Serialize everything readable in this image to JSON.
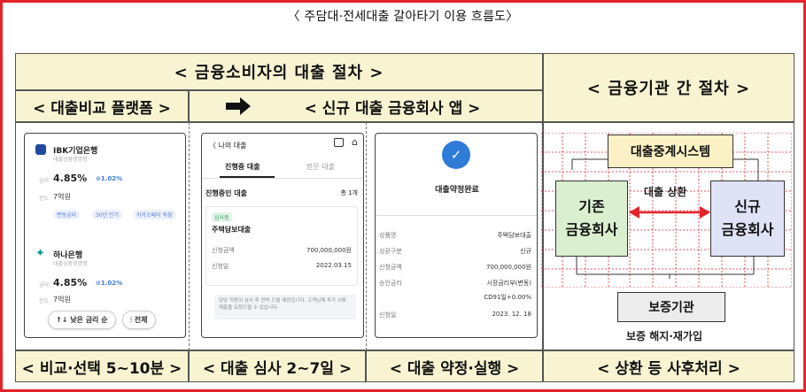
{
  "title": "〈 주담대·전세대출 갈아타기 이용 흐름도〉",
  "headers": {
    "consumer": "< 금융소비자의 대출 절차 >",
    "institution": "< 금융기관 간 절차 >",
    "platform": "< 대출비교 플랫폼 >",
    "app": "< 신규 대출 금융회사 앱 >"
  },
  "footers": {
    "compare": "< 비교·선택 5~10분 >",
    "review": "< 대출 심사 2~7일 >",
    "contract": "< 대출 약정·실행 >",
    "after": "< 상환 등 사후처리 >"
  },
  "panel1": {
    "banks": [
      {
        "name": "IBK기업은행",
        "sub": "대출상품명명명",
        "rate_label": "금리",
        "rate": "4.85%",
        "rate_delta": "⊙1.02%",
        "limit_label": "한도",
        "limit": "7억원",
        "tags": [
          "변동금리",
          "30년 만기",
          "카카오페이 독점"
        ]
      },
      {
        "name": "하나은행",
        "sub": "대출상품명명명",
        "rate_label": "금리",
        "rate": "4.85%",
        "rate_delta": "⊙1.02%",
        "limit_label": "한도",
        "limit": "7억원"
      }
    ],
    "sort_button": "↑↓ 낮은 금리 순",
    "filter_button": "전체"
  },
  "panel2": {
    "back": "〈 나의 대출",
    "tab_active": "진행중 대출",
    "tab_inactive": "받은 대출",
    "section": "진행중인 대출",
    "count": "총 1개",
    "badge": "심사중",
    "product": "주택담보대출",
    "rows": [
      {
        "label": "신청금액",
        "value": "700,000,000원"
      },
      {
        "label": "신청일",
        "value": "2022.03.15"
      }
    ],
    "notice": "담당 직원이 심사 후 연락 드릴 예정입니다. 고객님께 추가 서류 제출을 요청드릴 수 있습니다."
  },
  "panel3": {
    "done": "대출약정완료",
    "rows": [
      {
        "label": "상품명",
        "value": "주택담보대출"
      },
      {
        "label": "상환구분",
        "value": "신규"
      },
      {
        "label": "신청금액",
        "value": "700,000,000원"
      },
      {
        "label": "승인금리",
        "value": "시장금리부(변동)"
      },
      {
        "label": "",
        "value": "CD91일+0.00%"
      },
      {
        "label": "신청일",
        "value": "2023. 12. 18"
      }
    ]
  },
  "diagram": {
    "relay": "대출중계시스템",
    "old_bank": "기존\n금융회사",
    "new_bank": "신규\n금융회사",
    "repay_label": "대출 상환",
    "guarantee": "보증기관",
    "guarantee_note": "보증 해지·재가입"
  },
  "colors": {
    "frame": "#e3242b",
    "band": "#f8f4d2",
    "relay": "#fbf1c4",
    "old_bank": "#d9efcf",
    "new_bank": "#dfe3f6",
    "guarantee": "#ececec",
    "arrow": "#e3242b"
  }
}
